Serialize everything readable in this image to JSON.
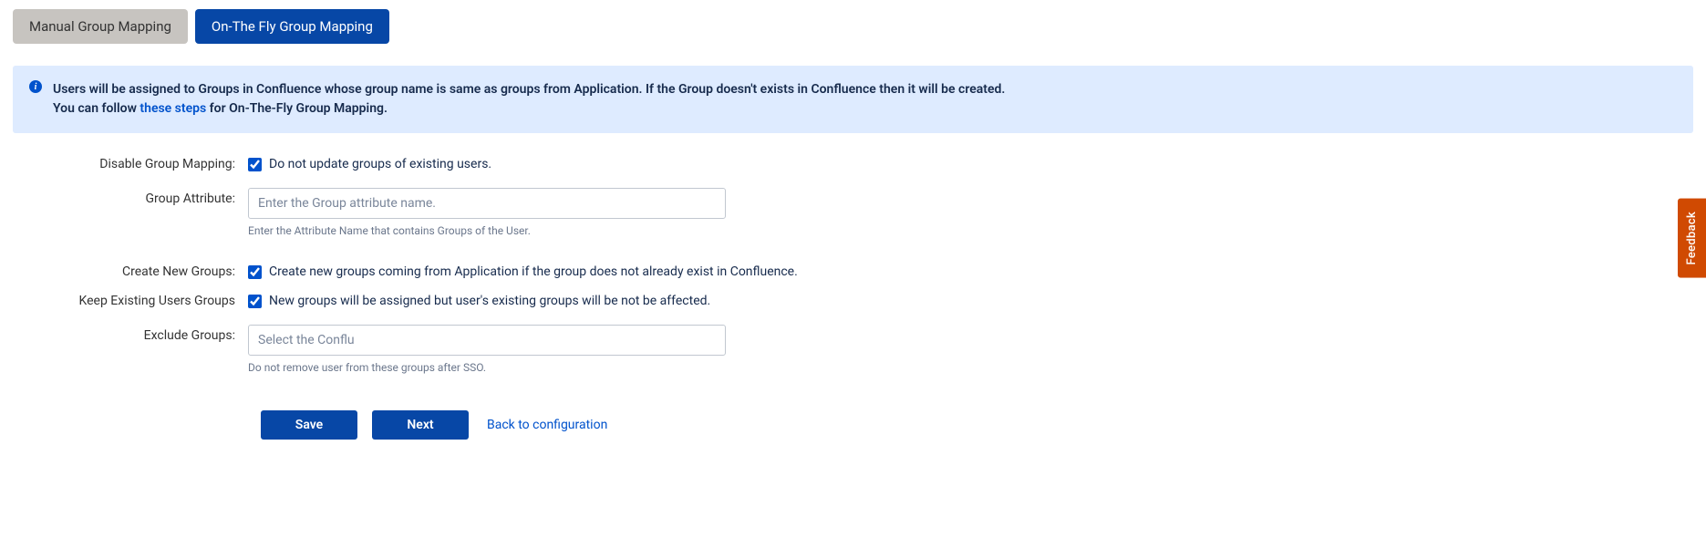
{
  "tabs": {
    "manual": "Manual Group Mapping",
    "onthefly": "On-The Fly Group Mapping"
  },
  "info": {
    "line1a": "Users will be assigned to Groups in Confluence whose group name is same as groups from Application. If the Group doesn't exists in Confluence then it will be created.",
    "line2a": "You can follow ",
    "link": "these steps",
    "line2b": " for On-The-Fly Group Mapping."
  },
  "labels": {
    "disable_group_mapping": "Disable Group Mapping:",
    "group_attribute": "Group Attribute:",
    "create_new_groups": "Create New Groups:",
    "keep_existing": "Keep Existing Users Groups",
    "exclude_groups": "Exclude Groups:"
  },
  "fields": {
    "disable_checkbox_label": "Do not update groups of existing users.",
    "group_attribute_placeholder": "Enter the Group attribute name.",
    "group_attribute_help": "Enter the Attribute Name that contains Groups of the User.",
    "create_checkbox_label": "Create new groups coming from Application if the group does not already exist in Confluence.",
    "keep_checkbox_label": "New groups will be assigned but user's existing groups will be not be affected.",
    "exclude_placeholder": "Select the Conflu",
    "exclude_help": "Do not remove user from these groups after SSO."
  },
  "actions": {
    "save": "Save",
    "next": "Next",
    "back": "Back to configuration"
  },
  "feedback": "Feedback"
}
